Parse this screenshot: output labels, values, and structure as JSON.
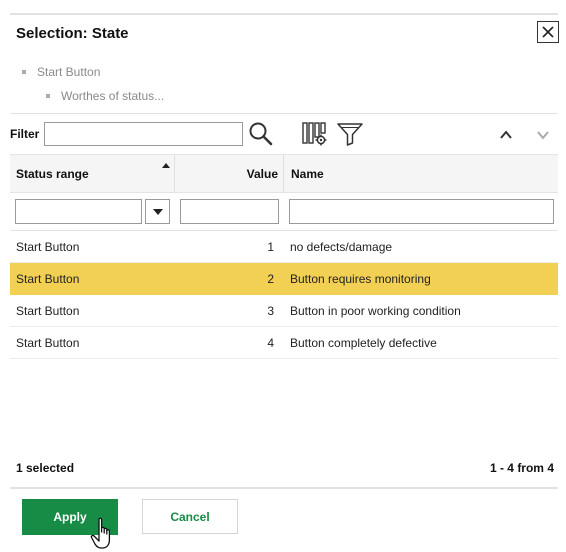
{
  "dialog": {
    "title": "Selection: State"
  },
  "breadcrumb": [
    "Start Button",
    "Worthes of status..."
  ],
  "toolbar": {
    "filter_label": "Filter",
    "filter_value": "",
    "icons": [
      "search-icon",
      "column-settings-icon",
      "filter-funnel-icon",
      "chevron-up-icon",
      "chevron-down-icon"
    ]
  },
  "table": {
    "columns": [
      "Status range",
      "Value",
      "Name"
    ],
    "sort_column": "Status range",
    "rows": [
      {
        "range": "Start Button",
        "value": "1",
        "name": "no defects/damage",
        "selected": false
      },
      {
        "range": "Start Button",
        "value": "2",
        "name": "Button requires monitoring",
        "selected": true
      },
      {
        "range": "Start Button",
        "value": "3",
        "name": "Button in poor working condition",
        "selected": false
      },
      {
        "range": "Start Button",
        "value": "4",
        "name": "Button completely defective",
        "selected": false
      }
    ]
  },
  "footer": {
    "selected_count": "1 selected",
    "paging": "1 - 4 from 4",
    "apply_label": "Apply",
    "cancel_label": "Cancel"
  },
  "colors": {
    "selected_row": "#f1d054",
    "accent_green": "#178c46",
    "header_bg": "#f5f5f5"
  }
}
